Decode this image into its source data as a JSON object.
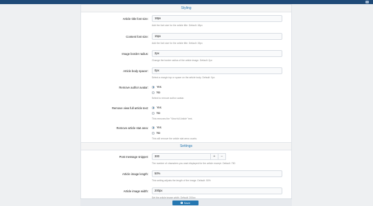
{
  "sections": [
    {
      "title": "Styling"
    },
    {
      "title": "Settings"
    }
  ],
  "fields": {
    "title_font_size": {
      "label": "Article title font size:",
      "value": "18px",
      "hint": "Add the font size for the article title. Default: 18px"
    },
    "content_font_size": {
      "label": "Content font size:",
      "value": "15px",
      "hint": "Add the font size for the article title. Default: 15px"
    },
    "image_border_radius": {
      "label": "Image border radius:",
      "value": "2px",
      "hint": "Change the border radius of the article image. Default: 2px"
    },
    "body_spacer": {
      "label": "Article body spacer:",
      "value": "0px",
      "hint": "Select a margin top or space on the article body. Default: 0px"
    },
    "message_snippet": {
      "label": "Post message snippet:",
      "value": "300",
      "hint": "The number of characters you want displayed for the article excerpt. Default: 750",
      "plus": "+",
      "minus": "−"
    },
    "image_length": {
      "label": "Article image length:",
      "value": "50%",
      "hint": "This setting adjusts the length of the image. Default: 50%"
    },
    "image_width": {
      "label": "Article image width:",
      "value": "200px",
      "hint": "Set the article image width. Default: 200px"
    }
  },
  "radios": {
    "remove_author_avatar": {
      "label": "Remove author avatar:",
      "yes": "Yes",
      "no": "No",
      "hint": "Select to remove author avatar.",
      "selected": "yes"
    },
    "remove_view_full": {
      "label": "Remove view full article text:",
      "yes": "Yes",
      "no": "No",
      "hint": "This removes the \"View full Article\" text.",
      "selected": "yes"
    },
    "remove_stat_area": {
      "label": "Remove article stat area:",
      "yes": "Yes",
      "no": "No",
      "hint": "This will remove the article stat area counts.",
      "selected": "yes"
    }
  },
  "save_label": "Save",
  "colors": {
    "accent": "#2577b1",
    "topbar": "#1f4a78"
  }
}
